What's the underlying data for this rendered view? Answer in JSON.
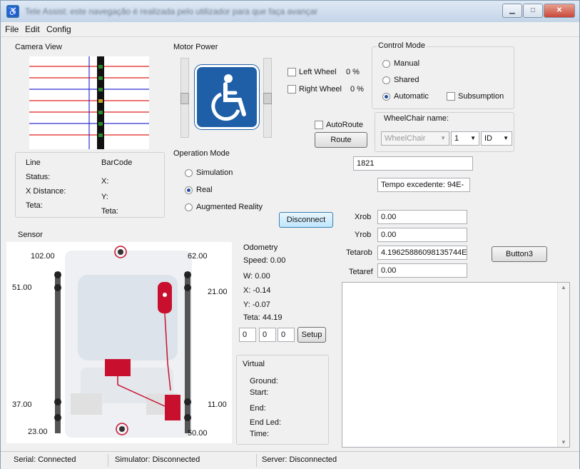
{
  "window": {
    "title": "Tele Assist: este navegação é realizada pelo utilizador para que faça avançar"
  },
  "menu": [
    "File",
    "Edit",
    "Config"
  ],
  "camera": {
    "title": "Camera View"
  },
  "line_panel": {
    "title": "Line",
    "status": "Status:",
    "xdist": "X Distance:",
    "teta": "Teta:"
  },
  "barcode_panel": {
    "title": "BarCode",
    "x": "X:",
    "y": "Y:",
    "teta": "Teta:"
  },
  "motor": {
    "title": "Motor Power",
    "left_wheel": "Left Wheel",
    "left_pct": "0 %",
    "right_wheel": "Right Wheel",
    "right_pct": "0 %"
  },
  "autoroute": {
    "label": "AutoRoute",
    "route_button": "Route"
  },
  "control_mode": {
    "title": "Control Mode",
    "manual": "Manual",
    "shared": "Shared",
    "automatic": "Automatic",
    "subsumption": "Subsumption",
    "selected": "Automatic"
  },
  "wheelchair": {
    "label": "WheelChair name:",
    "name": "WheelChair",
    "number": "1",
    "id": "ID"
  },
  "operation_mode": {
    "title": "Operation Mode",
    "simulation": "Simulation",
    "real": "Real",
    "augmented": "Augmented Reality",
    "selected": "Real"
  },
  "disconnect_button": "Disconnect",
  "field_1821": "1821",
  "tempo": "Tempo excedente: 94E-",
  "robot": {
    "xrob_label": "Xrob",
    "xrob": "0.00",
    "yrob_label": "Yrob",
    "yrob": "0.00",
    "tetarob_label": "Tetarob",
    "tetarob": "4.19625886098135744E",
    "tetaref_label": "Tetaref",
    "tetaref": "0.00"
  },
  "button3": "Button3",
  "sensor": {
    "title": "Sensor",
    "values": {
      "s102": "102.00",
      "s62": "62.00",
      "s51": "51.00",
      "s21": "21.00",
      "s37": "37.00",
      "s11": "11.00",
      "s23": "23.00",
      "s50": "50.00"
    }
  },
  "odometry": {
    "title": "Odometry",
    "speed": "Speed: 0.00",
    "w": "W: 0.00",
    "x": "X: -0.14",
    "y": "Y: -0.07",
    "teta": "Teta: 44.19",
    "in1": "0",
    "in2": "0",
    "in3": "0",
    "setup": "Setup"
  },
  "virtual": {
    "title": "Virtual",
    "ground": "Ground:",
    "start": "Start:",
    "end": "End:",
    "endled": "End Led:",
    "time": "Time:"
  },
  "statusbar": {
    "serial": "Serial: Connected",
    "simulator": "Simulator: Disconnected",
    "server": "Server: Disconnected"
  },
  "colors": {
    "accent": "#1f5fa8",
    "sensor_red": "#c8102e",
    "line_red": "#e02020",
    "line_blue": "#3030d0"
  }
}
